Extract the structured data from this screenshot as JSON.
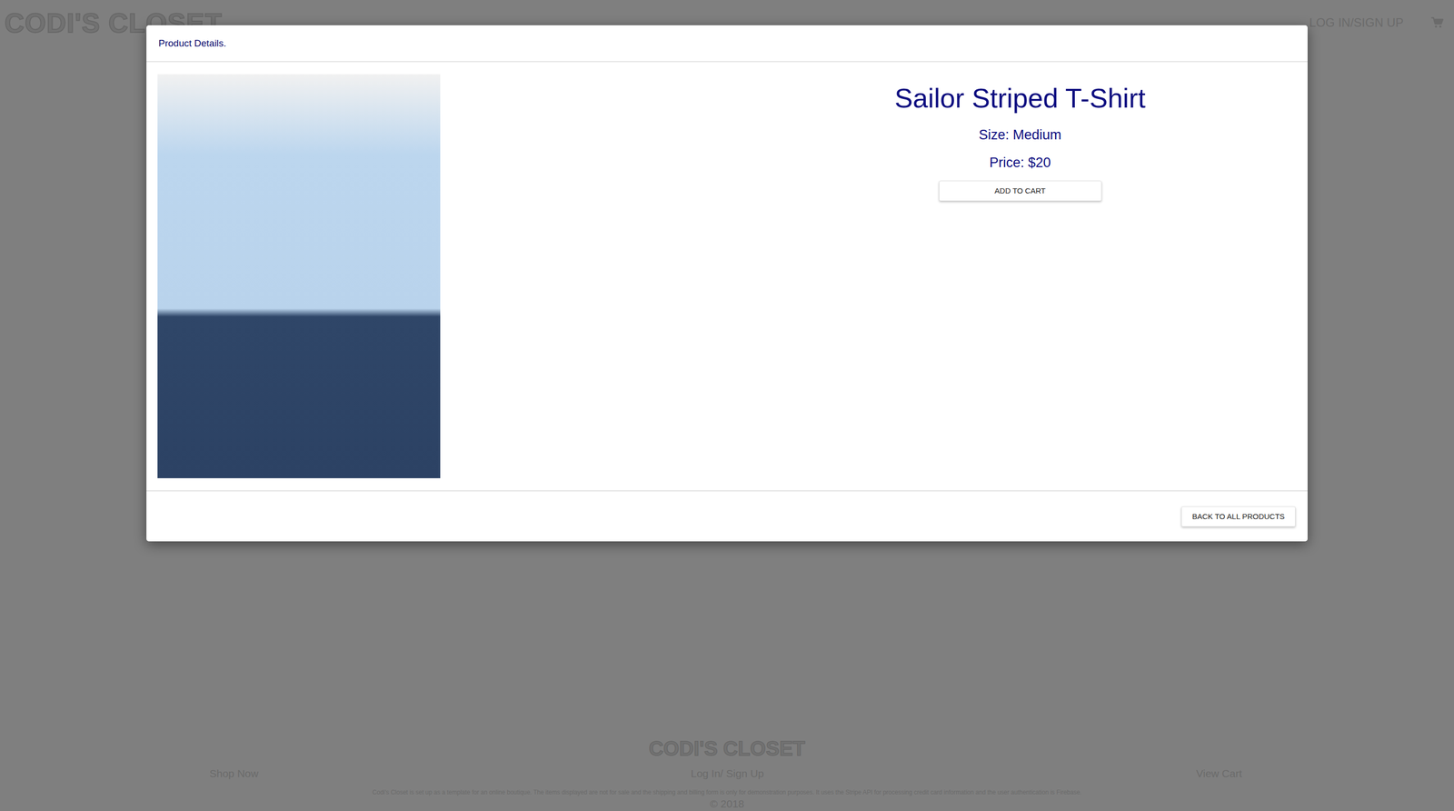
{
  "page": {
    "logo": "CODI'S CLOSET",
    "nav": [
      {
        "label": "LOG IN/SIGN UP"
      }
    ]
  },
  "footer": {
    "logo": "CODI'S CLOSET",
    "links": [
      "Shop Now",
      "Log In/ Sign Up",
      "View Cart"
    ],
    "disclaimer": "Codi's Closet is set up as a template for an online boutique. The items displayed are not for sale and the shipping and billing form is only for demonstration purposes. It uses the Stripe API for processing credit card information and the user authentication is Firebase.",
    "copyright": "© 2018"
  },
  "modal": {
    "title": "Product Details.",
    "product": {
      "name": "Sailor Striped T-Shirt",
      "size": "Size: Medium",
      "price": "Price: $20"
    },
    "buttons": {
      "add": "ADD TO CART",
      "back": "BACK TO ALL PRODUCTS"
    }
  }
}
